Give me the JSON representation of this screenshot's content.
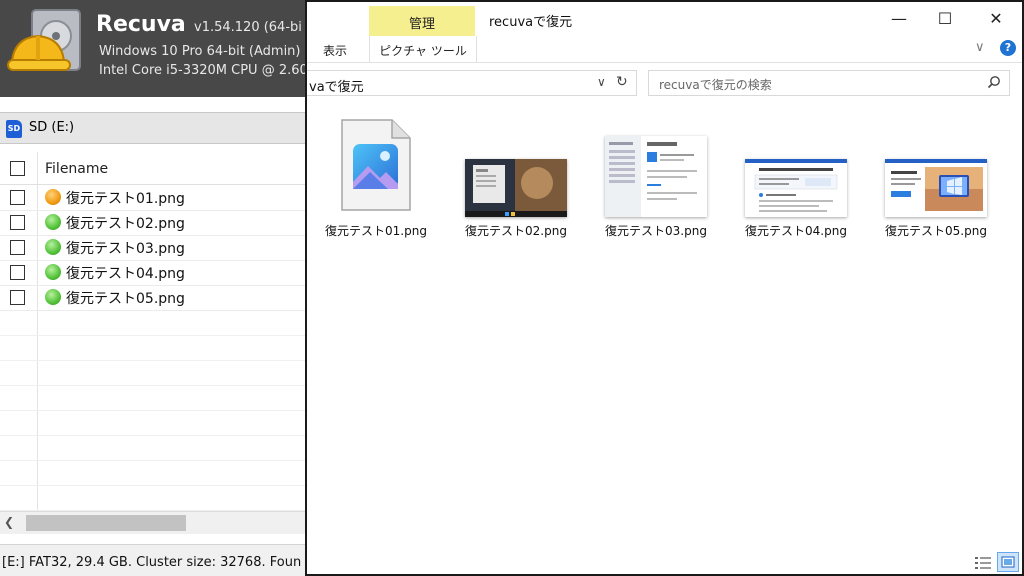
{
  "recuva": {
    "title": "Recuva",
    "version": "v1.54.120 (64-bi",
    "os": "Windows 10 Pro 64-bit (Admin)",
    "cpu": "Intel Core i5-3320M CPU @ 2.60",
    "drive": "SD (E:)",
    "drive_icon_text": "SD",
    "column_filename": "Filename",
    "files": [
      {
        "name": "復元テスト01.png",
        "state": "orange"
      },
      {
        "name": "復元テスト02.png",
        "state": "green"
      },
      {
        "name": "復元テスト03.png",
        "state": "green"
      },
      {
        "name": "復元テスト04.png",
        "state": "green"
      },
      {
        "name": "復元テスト05.png",
        "state": "green"
      }
    ],
    "status": "[E:] FAT32, 29.4 GB. Cluster size: 32768. Foun"
  },
  "explorer": {
    "manage_tab": "管理",
    "title": "recuvaで復元",
    "controls": {
      "minimize": "—",
      "maximize": "☐",
      "close": "✕"
    },
    "tab_view": "表示",
    "tab_picture_tools": "ピクチャ ツール",
    "address_text": "vaで復元",
    "search_placeholder": "recuvaで復元の検索",
    "items": [
      {
        "label": "復元テスト01.png",
        "kind": "generic-image-file"
      },
      {
        "label": "復元テスト02.png",
        "kind": "desktop-screenshot"
      },
      {
        "label": "復元テスト03.png",
        "kind": "settings-screenshot"
      },
      {
        "label": "復元テスト04.png",
        "kind": "webpage-screenshot"
      },
      {
        "label": "復元テスト05.png",
        "kind": "windows11-screenshot"
      }
    ]
  },
  "colors": {
    "recuva_header": "#484848",
    "manage_tab": "#f6ef8f",
    "accent_blue": "#1f73d2",
    "dot_orange": "#f09a12",
    "dot_green": "#52c238"
  }
}
